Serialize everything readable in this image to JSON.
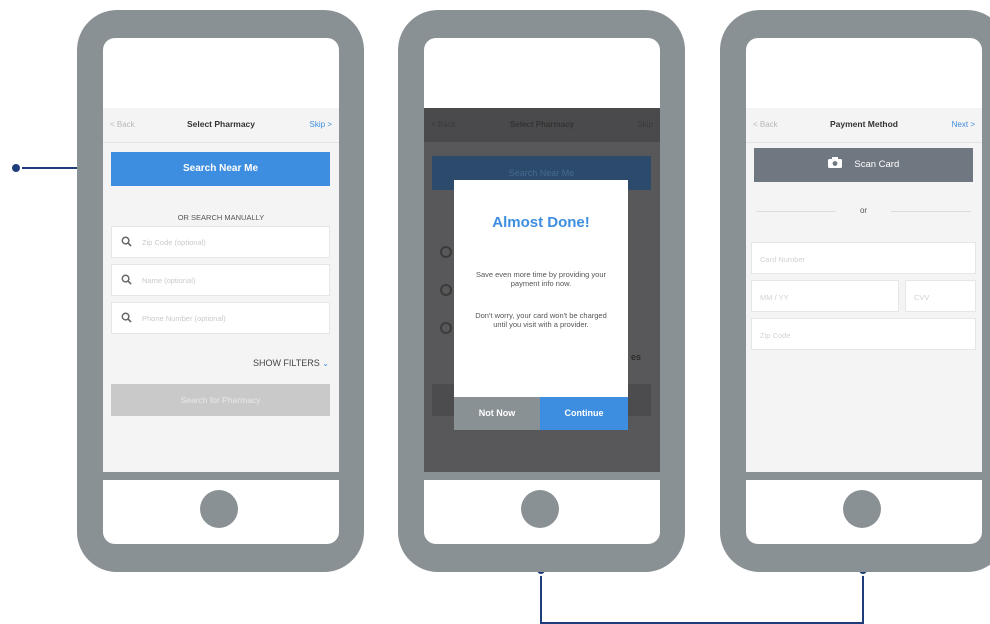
{
  "screen1": {
    "nav": {
      "back": "< Back",
      "title": "Select Pharmacy",
      "right": "Skip >"
    },
    "search_near_me": "Search Near Me",
    "or_label": "OR SEARCH MANUALLY",
    "fields": [
      "Zip Code (optional)",
      "Name (optional)",
      "Phone Number (optional)"
    ],
    "show_filters": "SHOW FILTERS",
    "show_filters_chevron": "⌄",
    "search_button": "Search for Pharmacy"
  },
  "screen2": {
    "nav": {
      "back": "< Back",
      "title": "Select Pharmacy",
      "right": "Skip"
    },
    "background_button": "Search Near Me",
    "background_fragment": "es",
    "modal": {
      "title": "Almost Done!",
      "text1": "Save even more time by providing your payment info now.",
      "text2": "Don't worry, your card won't be charged until you visit with a provider.",
      "secondary": "Not Now",
      "primary": "Continue"
    }
  },
  "screen3": {
    "nav": {
      "back": "< Back",
      "title": "Payment Method",
      "right": "Next >"
    },
    "scan_card": "Scan Card",
    "or": "or",
    "card_number": "Card Number",
    "expiry": "MM / YY",
    "cvv": "CVV",
    "zip": "Zip Code"
  },
  "colors": {
    "accent": "#3d8de0",
    "connector": "#1f3d7a",
    "phone": "#8a9195"
  }
}
